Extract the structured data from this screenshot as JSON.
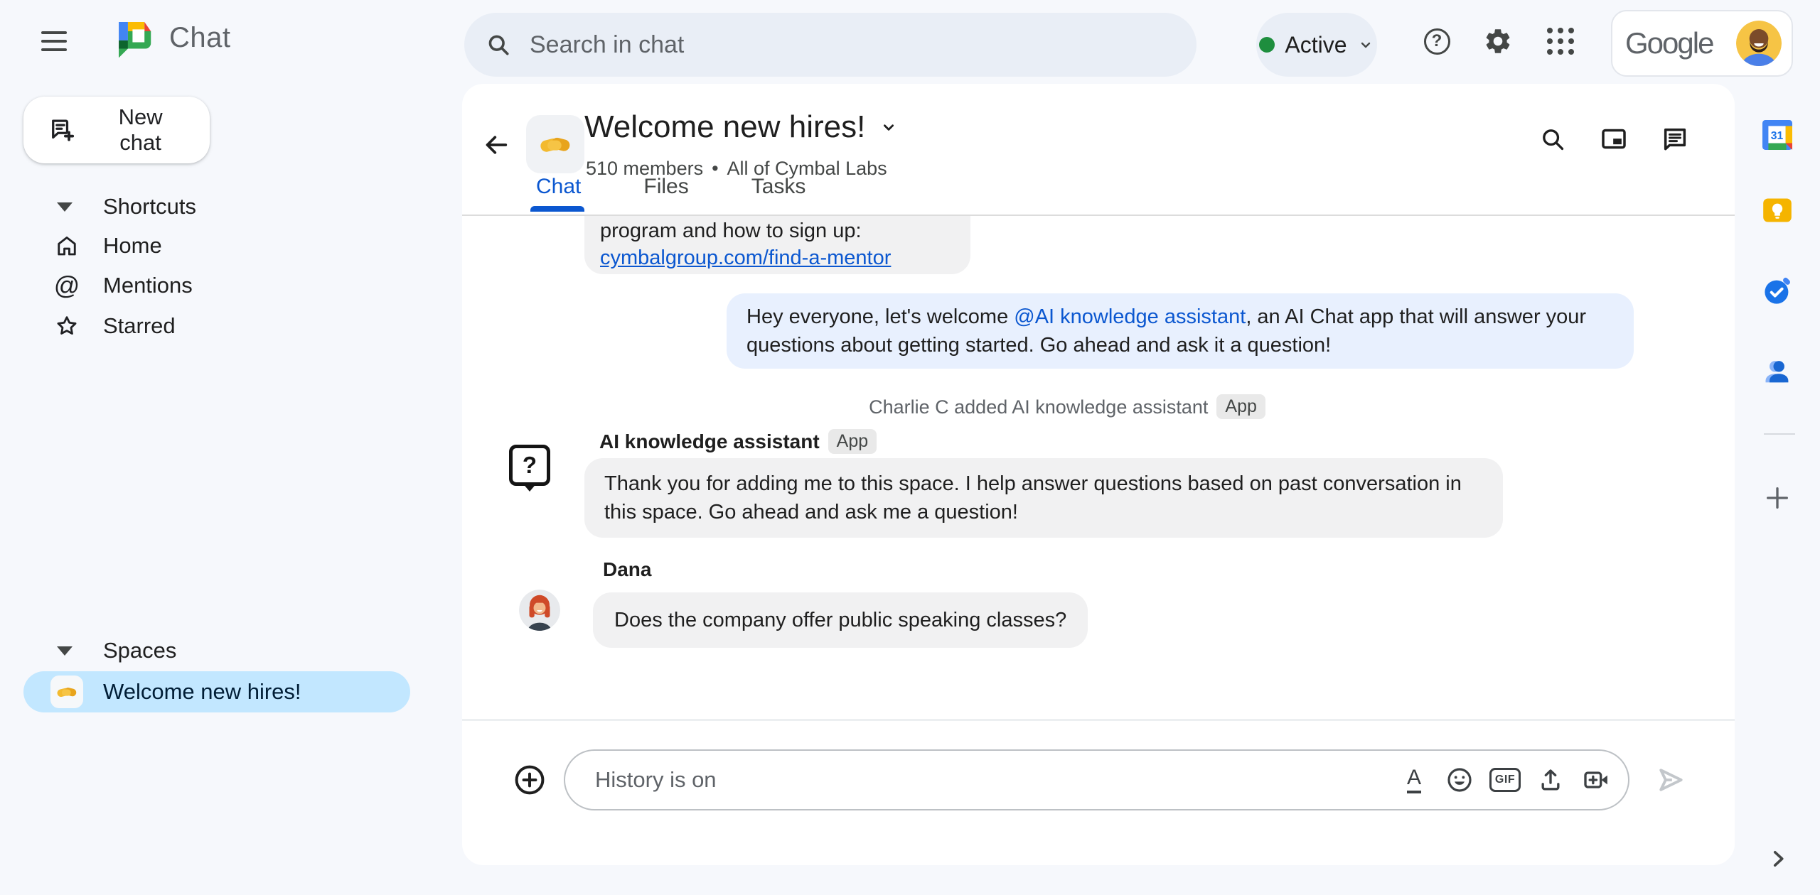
{
  "topbar": {
    "app_name": "Chat",
    "search_placeholder": "Search in chat",
    "status": "Active",
    "google_logo": "Google"
  },
  "sidebar": {
    "new_chat_label": "New chat",
    "sections": [
      {
        "label": "Shortcuts",
        "items": [
          {
            "label": "Home"
          },
          {
            "label": "Mentions"
          },
          {
            "label": "Starred"
          }
        ]
      },
      {
        "label": "Spaces",
        "items": [
          {
            "label": "Welcome new hires!",
            "selected": true
          }
        ]
      }
    ]
  },
  "chat_header": {
    "title": "Welcome new hires!",
    "members": "510 members",
    "separator": "•",
    "org": "All of Cymbal Labs",
    "tabs": [
      {
        "label": "Chat",
        "active": true
      },
      {
        "label": "Files"
      },
      {
        "label": "Tasks"
      }
    ]
  },
  "messages": [
    {
      "type": "continuation",
      "text": "program and how to sign up:",
      "link": "cymbalgroup.com/find-a-mentor"
    },
    {
      "type": "outgoing",
      "pre": "Hey everyone, let's welcome ",
      "mention": "@AI knowledge assistant",
      "post": ", an AI Chat app that will answer your questions about getting started.  Go ahead and ask it a question!"
    },
    {
      "type": "system",
      "text": "Charlie C added AI knowledge assistant",
      "badge": "App"
    },
    {
      "type": "app",
      "sender": "AI knowledge assistant",
      "badge": "App",
      "text": "Thank you for adding me to this space. I help answer questions based on past conversation in this space. Go ahead and ask me a question!"
    },
    {
      "type": "user",
      "sender": "Dana",
      "text": "Does the company offer public speaking classes?"
    }
  ],
  "compose": {
    "placeholder": "History is on"
  },
  "glyphs": {
    "help": "?",
    "at": "@",
    "ai_question": "?",
    "format_a": "A",
    "gif": "GIF",
    "calendar_day": "31"
  },
  "colors": {
    "page-bg": "#f6f8fc",
    "panel-bg": "#ffffff",
    "chip-bg": "#e9eef6",
    "accent-blue": "#0b57d0",
    "active-green": "#1e8e3e",
    "selected-space-bg": "#c2e7ff",
    "bubble-grey": "#f1f1f2",
    "bubble-blue": "#e8f0fe",
    "text-primary": "#1f1f1f",
    "text-secondary": "#5f6368",
    "icon-grey": "#444746",
    "badge-bg": "#e9e9e9"
  }
}
